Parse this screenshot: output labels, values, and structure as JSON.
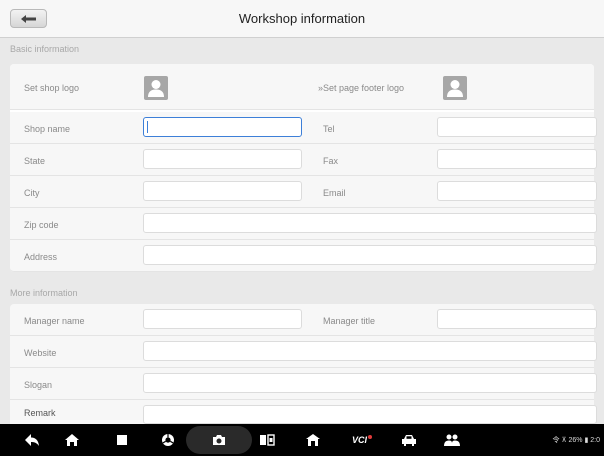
{
  "header": {
    "title": "Workshop information"
  },
  "sections": {
    "basic": "Basic information",
    "more": "More information"
  },
  "basic": {
    "shop_logo_label": "Set shop logo",
    "footer_logo_label": "»Set page footer logo",
    "shop_name_label": "Shop name",
    "shop_name_value": "",
    "tel_label": "Tel",
    "state_label": "State",
    "fax_label": "Fax",
    "city_label": "City",
    "email_label": "Email",
    "zip_label": "Zip code",
    "address_label": "Address"
  },
  "more": {
    "manager_name_label": "Manager name",
    "manager_title_label": "Manager title",
    "website_label": "Website",
    "slogan_label": "Slogan",
    "remark_label": "Remark"
  },
  "navbar": {
    "icons": [
      "back-icon",
      "home-icon",
      "recent-apps-icon",
      "browser-icon",
      "camera-icon",
      "screen-mirror-icon",
      "workshop-home-icon",
      "vci-icon",
      "car-icon",
      "users-icon"
    ],
    "vci_label": "VCI",
    "status_text": "令 ⊼ 26% ▮ 2:0"
  },
  "colors": {
    "accent": "#3d7fd8",
    "background": "#e9e9e9"
  }
}
